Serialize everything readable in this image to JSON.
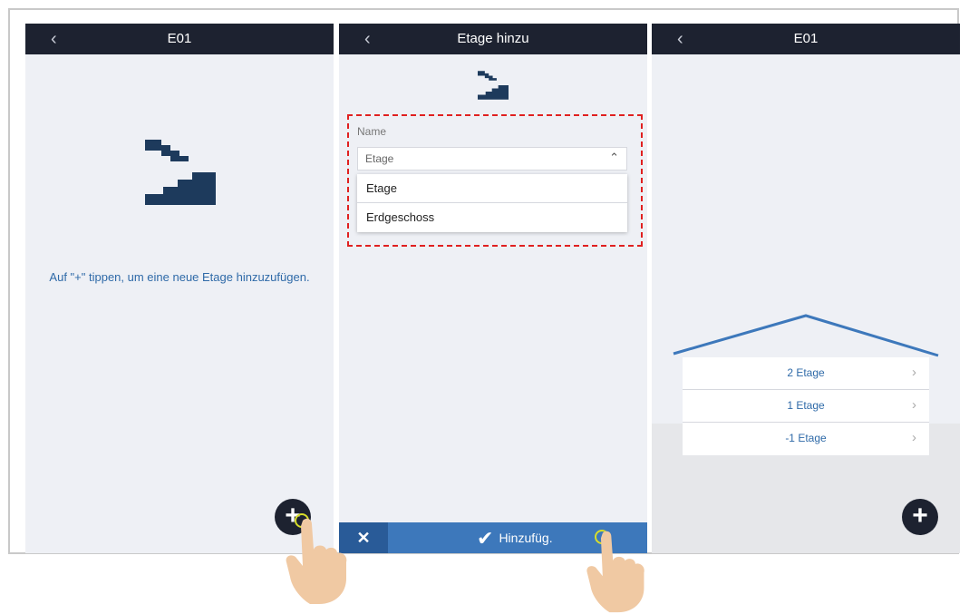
{
  "screen1": {
    "title": "E01",
    "back_icon": "‹",
    "hint": "Auf \"+\" tippen, um eine neue Etage hinzuzufügen.",
    "fab_label": "+"
  },
  "screen2": {
    "title": "Etage hinzu",
    "back_icon": "‹",
    "name_label": "Name",
    "select_value": "Etage",
    "chevron": "⌃",
    "options": [
      "Etage",
      "Erdgeschoss"
    ],
    "cancel_label": "✕",
    "add_label": "Hinzufüg.",
    "check_icon": "✔"
  },
  "screen3": {
    "title": "E01",
    "back_icon": "‹",
    "floors": [
      "2 Etage",
      "1 Etage",
      "-1 Etage"
    ],
    "arrow": "›",
    "fab_label": "+"
  },
  "colors": {
    "topbar": "#1d2230",
    "accent_blue": "#2f6aa8",
    "action_bar": "#3d78bb",
    "highlight_dash": "#e02020",
    "touch_ring": "#d8de2a"
  }
}
